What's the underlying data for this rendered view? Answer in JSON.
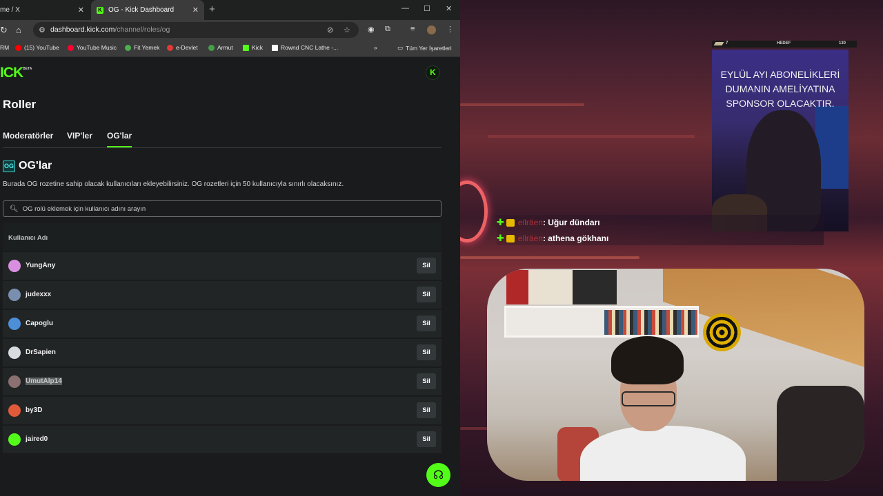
{
  "browser": {
    "tabs": [
      {
        "title": "me / X"
      },
      {
        "title": "OG - Kick Dashboard",
        "favicon": "K"
      }
    ],
    "address": {
      "host": "dashboard.kick.com",
      "path": "/channel/roles/og"
    },
    "bookmarks": [
      {
        "label": "RM"
      },
      {
        "label": "(15) YouTube",
        "color": "#ff0000"
      },
      {
        "label": "YouTube Music",
        "color": "#ff0033"
      },
      {
        "label": "Fit Yemek",
        "color": "#4caf50"
      },
      {
        "label": "e-Devlet",
        "color": "#e53935"
      },
      {
        "label": "Armut",
        "color": "#43a047"
      },
      {
        "label": "Kick",
        "color": "#53fc18"
      },
      {
        "label": "Rownd CNC Lathe -...",
        "color": "#ffffff"
      },
      {
        "label": "Tüm Yer İşaretleri"
      }
    ]
  },
  "kick": {
    "logo": "ICK",
    "logo_beta": "BETA",
    "profile_letter": "K",
    "page_title": "Roller",
    "tabs": [
      "Moderatörler",
      "VIP'ler",
      "OG'lar"
    ],
    "section": {
      "badge": "OG",
      "title": "OG'lar",
      "description": "Burada OG rozetine sahip olacak kullanıcıları ekleyebilirsiniz. OG rozetleri için 50 kullanıcıyla sınırlı olacaksınız."
    },
    "search": {
      "placeholder": "OG rolü eklemek için kullanıcı adını arayın",
      "value": ""
    },
    "table": {
      "header": "Kullanıcı Adı",
      "remove_label": "Sil",
      "rows": [
        {
          "name": "YungAny",
          "avatar": "#d98fe0",
          "selected": false
        },
        {
          "name": "judexxx",
          "avatar": "#7a8fb0",
          "selected": false
        },
        {
          "name": "Capoglu",
          "avatar": "#4c8fd8",
          "selected": false
        },
        {
          "name": "DrSapien",
          "avatar": "#d8dce0",
          "selected": false
        },
        {
          "name": "UmutAlp14",
          "avatar": "#8a7070",
          "selected": true
        },
        {
          "name": "by3D",
          "avatar": "#e05a3a",
          "selected": false
        },
        {
          "name": "jaired0",
          "avatar": "#53fc18",
          "selected": false
        }
      ]
    }
  },
  "stream": {
    "goal": {
      "left": "7",
      "label": "HEDEF",
      "right": "130"
    },
    "announcement": "EYLÜL AYI ABONELİKLERİ DUMANIN AMELİYATINA SPONSOR OLACAKTIR.",
    "chat": [
      {
        "user": "ellräen",
        "text": ": Uğur dündarı"
      },
      {
        "user": "ellräen",
        "text": ": athena gökhanı"
      }
    ]
  }
}
